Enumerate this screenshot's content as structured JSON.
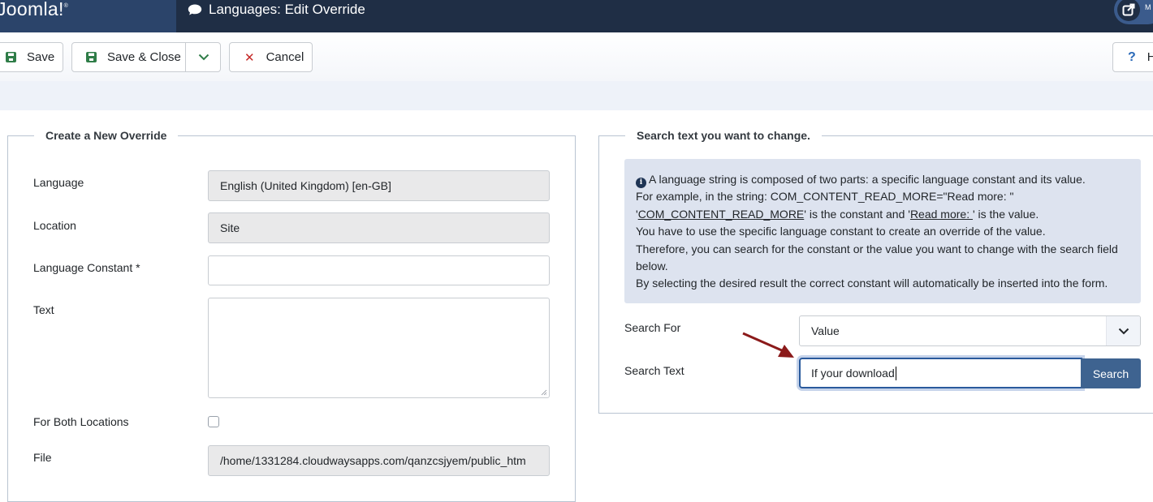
{
  "header": {
    "logo": "Joomla!",
    "page_title": "Languages: Edit Override",
    "user_label": "M"
  },
  "toolbar": {
    "save_label": "Save",
    "save_close_label": "Save & Close",
    "cancel_label": "Cancel",
    "help_label": "H"
  },
  "left_panel": {
    "legend": "Create a New Override",
    "fields": {
      "language_label": "Language",
      "language_value": "English (United Kingdom) [en-GB]",
      "location_label": "Location",
      "location_value": "Site",
      "constant_label": "Language Constant *",
      "constant_value": "",
      "text_label": "Text",
      "text_value": "",
      "both_locations_label": "For Both Locations",
      "both_locations_checked": false,
      "file_label": "File",
      "file_value": "/home/1331284.cloudwaysapps.com/qanzcsjyem/public_htm"
    }
  },
  "right_panel": {
    "legend": "Search text you want to change.",
    "info": {
      "line1": "A language string is composed of two parts: a specific language constant and its value.",
      "line2": "For example, in the string: COM_CONTENT_READ_MORE=\"Read more: \"",
      "line3_constant": "COM_CONTENT_READ_MORE",
      "line3_mid": "' is the constant and '",
      "line3_value": "Read more: ",
      "line3_end": "' is the value.",
      "line4": "You have to use the specific language constant to create an override of the value.",
      "line5": "Therefore, you can search for the constant or the value you want to change with the search field below.",
      "line6": "By selecting the desired result the correct constant will automatically be inserted into the form."
    },
    "search_for_label": "Search For",
    "search_for_value": "Value",
    "search_text_label": "Search Text",
    "search_text_value": "If your download",
    "search_button": "Search"
  },
  "colors": {
    "header_bg": "#1f2e45",
    "brand_bg": "#2b446a",
    "primary_button": "#3e6390",
    "save_icon": "#2f7d48",
    "cancel_icon": "#c52827",
    "annotation_arrow": "#8b1a1a"
  }
}
